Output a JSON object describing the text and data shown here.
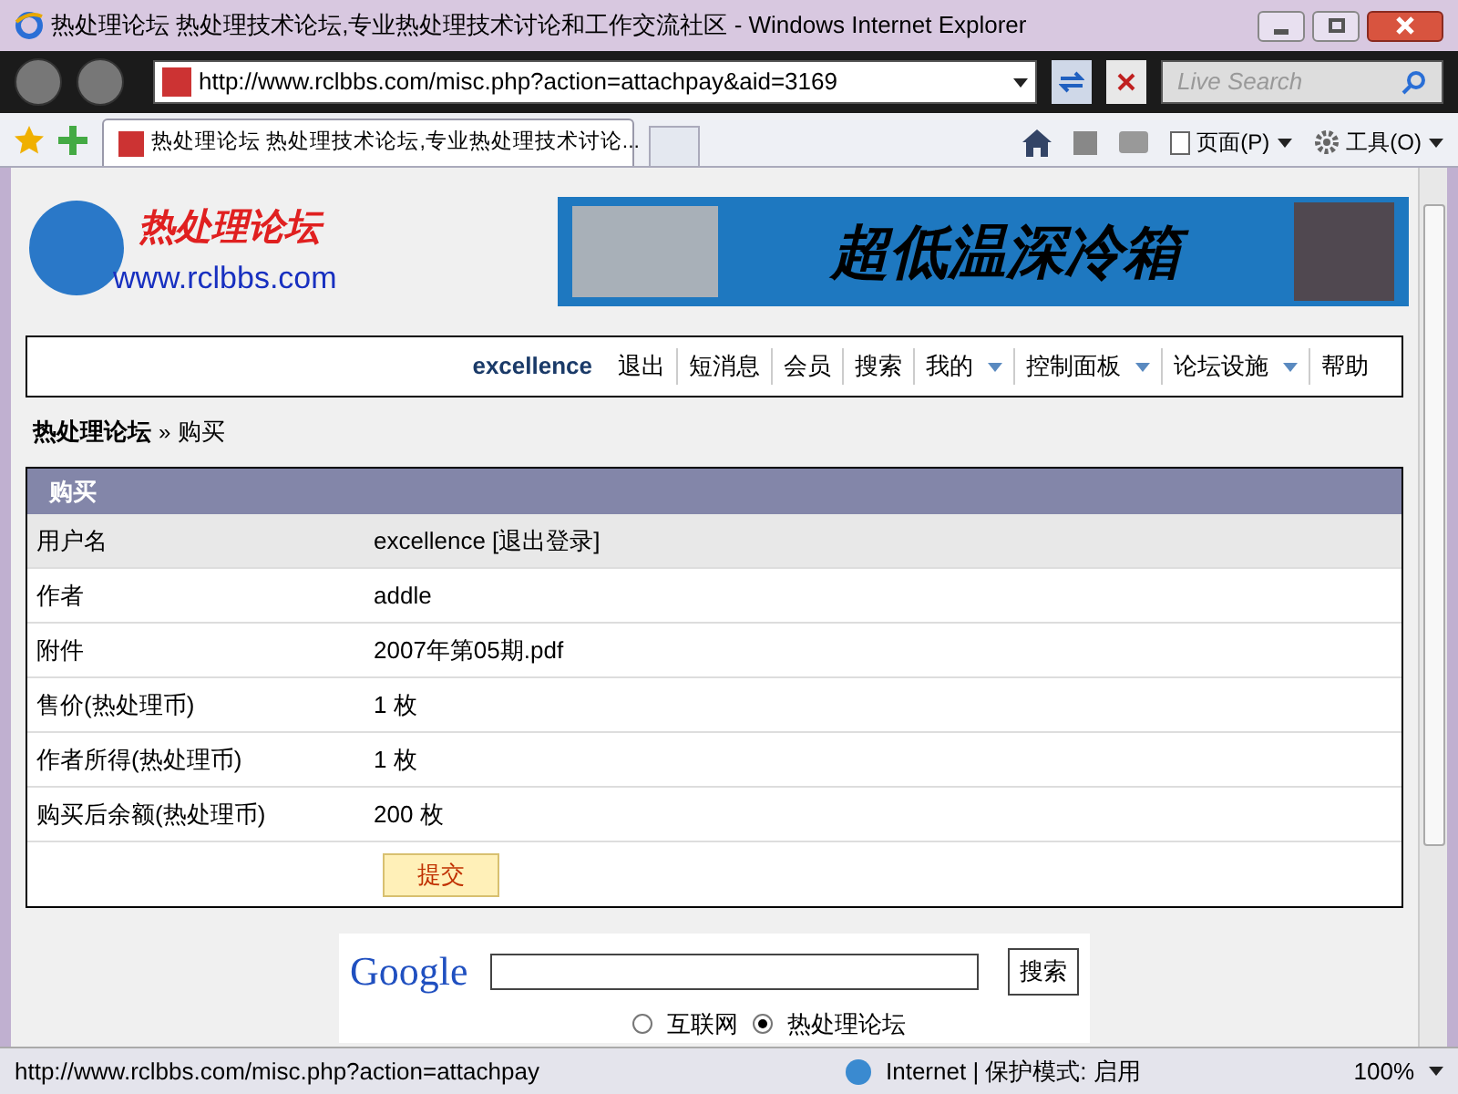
{
  "window": {
    "title": "热处理论坛 热处理技术论坛,专业热处理技术讨论和工作交流社区 - Windows Internet Explorer"
  },
  "address_bar": {
    "value": "http://www.rclbbs.com/misc.php?action=attachpay&aid=3169"
  },
  "search_box": {
    "placeholder": "Live Search"
  },
  "tab": {
    "label": "热处理论坛 热处理技术论坛,专业热处理技术讨论...",
    "selected": true
  },
  "command_bar": [
    {
      "label": "页面(P)",
      "kind": "page"
    },
    {
      "label": "工具(O)",
      "kind": "tools"
    }
  ],
  "logo": {
    "name": "热处理论坛",
    "url": "www.rclbbs.com"
  },
  "banner": {
    "text": "超低温深冷箱"
  },
  "nav": {
    "user": "excellence",
    "items": [
      {
        "label": "退出",
        "dropdown": false
      },
      {
        "label": "短消息",
        "dropdown": false
      },
      {
        "label": "会员",
        "dropdown": false
      },
      {
        "label": "搜索",
        "dropdown": false
      },
      {
        "label": "我的",
        "dropdown": true
      },
      {
        "label": "控制面板",
        "dropdown": true
      },
      {
        "label": "论坛设施",
        "dropdown": true
      },
      {
        "label": "帮助",
        "dropdown": false
      }
    ]
  },
  "breadcrumb": {
    "home": "热处理论坛",
    "separator": "»",
    "current": "购买"
  },
  "purchase_table": {
    "title": "购买",
    "rows": [
      {
        "label": "用户名",
        "value": "excellence [退出登录]"
      },
      {
        "label": "作者",
        "value": "addle"
      },
      {
        "label": "附件",
        "value": "2007年第05期.pdf"
      },
      {
        "label": "售价(热处理币)",
        "value": "1 枚"
      },
      {
        "label": "作者所得(热处理币)",
        "value": "1 枚"
      },
      {
        "label": "购买后余额(热处理币)",
        "value": "200 枚"
      }
    ],
    "submit": "提交"
  },
  "google_search": {
    "logo": "Google",
    "button": "搜索",
    "options": [
      {
        "label": "互联网",
        "selected": false
      },
      {
        "label": "热处理论坛",
        "selected": true
      }
    ]
  },
  "status_bar": {
    "url": "http://www.rclbbs.com/misc.php?action=attachpay",
    "zone": "Internet | 保护模式: 启用",
    "zoom": "100%"
  }
}
